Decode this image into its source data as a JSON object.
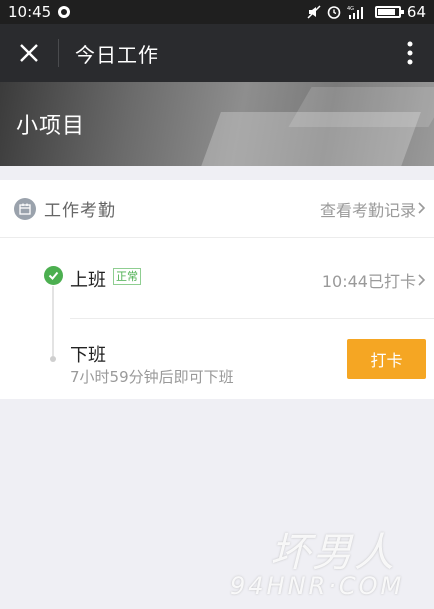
{
  "status_bar": {
    "time": "10:45",
    "battery_level": "64",
    "network": "4G"
  },
  "title_bar": {
    "title": "今日工作"
  },
  "banner": {
    "title": "小项目"
  },
  "attendance": {
    "header_label": "工作考勤",
    "records_link": "查看考勤记录",
    "check_in": {
      "label": "上班",
      "status": "正常",
      "time_text": "10:44已打卡"
    },
    "check_out": {
      "label": "下班",
      "hint": "7小时59分钟后即可下班",
      "button_label": "打卡"
    }
  },
  "watermark": {
    "cn": "坏男人",
    "en": "94HNR·COM"
  },
  "colors": {
    "accent": "#f5a623",
    "success": "#4caf50",
    "title_bar_bg": "#2a2b2e"
  }
}
